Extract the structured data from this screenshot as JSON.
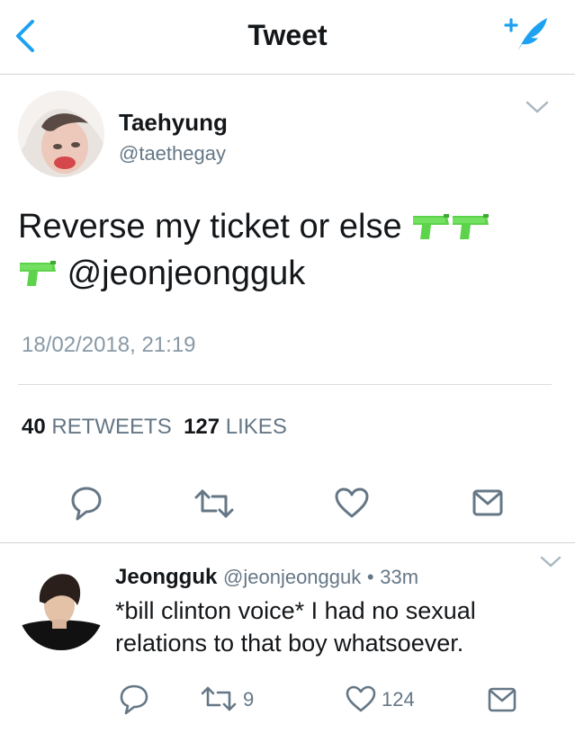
{
  "nav": {
    "title": "Tweet"
  },
  "tweet": {
    "display_name": "Taehyung",
    "handle": "@taethegay",
    "text_line1": "Reverse my ticket or else",
    "mention": "@jeonjeongguk",
    "timestamp": "18/02/2018, 21:19",
    "retweets_count": "40",
    "retweets_label": "RETWEETS",
    "likes_count": "127",
    "likes_label": "LIKES"
  },
  "reply": {
    "display_name": "Jeongguk",
    "handle": "@jeonjeongguk",
    "separator": "•",
    "time": "33m",
    "text": "*bill clinton voice* I had no sexual relations to that boy whatsoever.",
    "retweets": "9",
    "likes": "124"
  },
  "icons": {
    "back": "chevron-left-icon",
    "compose": "compose-feather-icon",
    "reply": "reply-bubble-icon",
    "retweet": "retweet-icon",
    "like": "heart-icon",
    "dm": "envelope-icon",
    "emoji": "water-pistol-emoji"
  },
  "colors": {
    "accent": "#1da1f2",
    "muted": "#657786",
    "text": "#14171a",
    "emoji_green": "#5cd34a"
  }
}
